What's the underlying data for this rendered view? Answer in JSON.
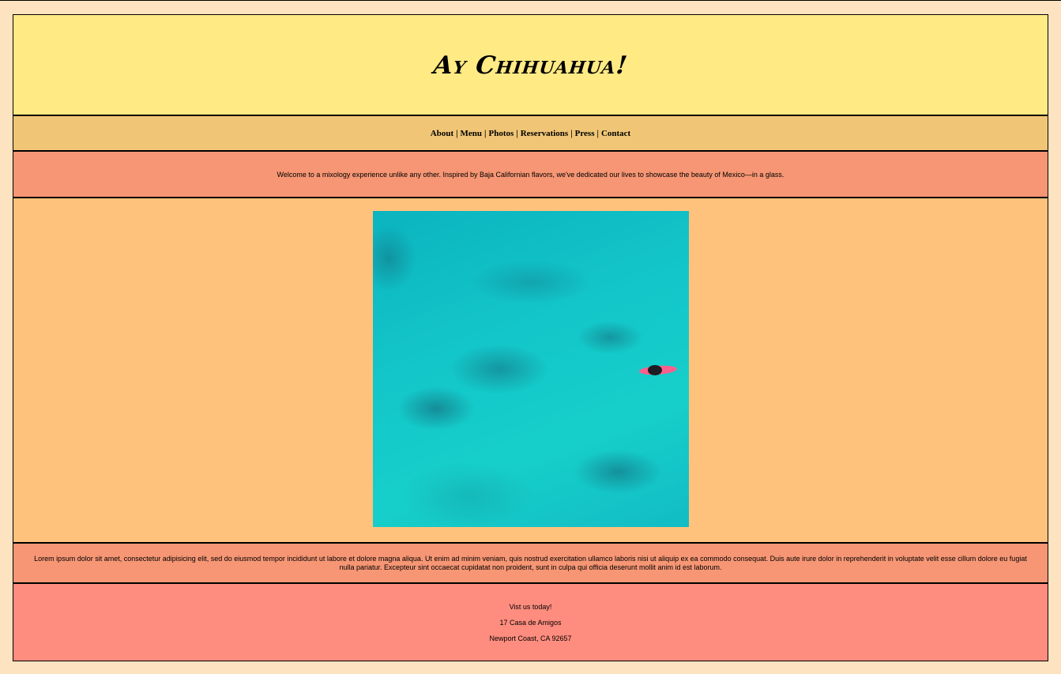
{
  "header": {
    "title": "Ay Chihuahua!"
  },
  "nav": {
    "items": [
      {
        "label": "About"
      },
      {
        "label": "Menu"
      },
      {
        "label": "Photos"
      },
      {
        "label": "Reservations"
      },
      {
        "label": "Press"
      },
      {
        "label": "Contact"
      }
    ],
    "separator": "|"
  },
  "intro": {
    "text": "Welcome to a mixology experience unlike any other. Inspired by Baja Californian flavors, we've dedicated our lives to showcase the beauty of Mexico—in a glass."
  },
  "photo": {
    "subject": "aerial view of a surfer on a pink surfboard in turquoise water"
  },
  "lorem": {
    "text": "Lorem ipsum dolor sit amet, consectetur adipisicing elit, sed do eiusmod tempor incididunt ut labore et dolore magna aliqua. Ut enim ad minim veniam, quis nostrud exercitation ullamco laboris nisi ut aliquip ex ea commodo consequat. Duis aute irure dolor in reprehenderit in voluptate velit esse cillum dolore eu fugiat nulla pariatur. Excepteur sint occaecat cupidatat non proident, sunt in culpa qui officia deserunt mollit anim id est laborum."
  },
  "footer": {
    "cta": "Vist us today!",
    "address_line1": "17 Casa de Amigos",
    "address_line2": "Newport Coast, CA 92657"
  },
  "colors": {
    "page_bg": "#fde3c0",
    "header_bg": "#ffea84",
    "nav_bg": "#f0c676",
    "intro_bg": "#f69674",
    "photo_section_bg": "#ffc27d",
    "footer_bg": "#ff8d7f"
  }
}
